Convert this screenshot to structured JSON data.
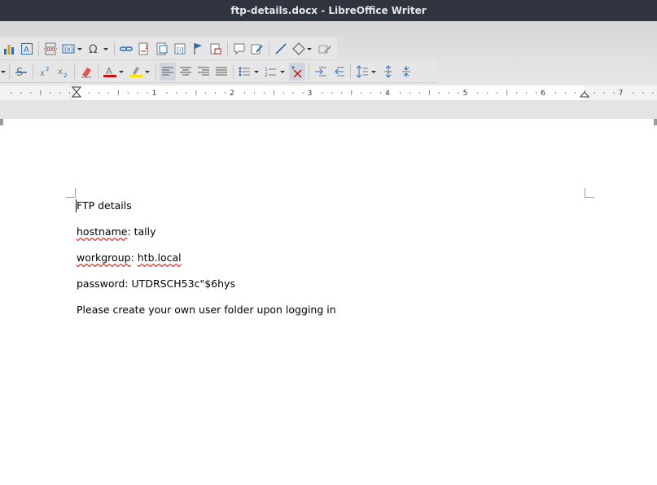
{
  "window": {
    "title": "ftp-details.docx - LibreOffice Writer"
  },
  "ruler": {
    "labels": [
      "1",
      "2",
      "3",
      "4",
      "5",
      "6",
      "7"
    ]
  },
  "document": {
    "heading": "FTP details",
    "hostname_label": "hostname",
    "hostname_value": ": tally",
    "workgroup_label": "workgroup",
    "workgroup_sep": ": ",
    "workgroup_value": "htb.local",
    "password_line": "password: UTDRSCH53c\"$6hys",
    "note": "Please create your own user folder upon logging in"
  },
  "colors": {
    "titlebar": "#2f343f",
    "font_color": "#cc1111",
    "highlight": "#f5e400",
    "accent_blue": "#2a6ebb"
  },
  "icons": {
    "toolbar1": [
      "chart-icon",
      "text-box-icon",
      "page-break-icon",
      "field-icon",
      "special-character-icon",
      "hyperlink-icon",
      "footnote-icon",
      "endnote-icon",
      "bookmark-icon",
      "cross-reference-icon",
      "comment-icon",
      "track-changes-icon",
      "line-icon",
      "basic-shapes-icon",
      "draw-icon"
    ],
    "toolbar2": [
      "strikethrough-icon",
      "superscript-icon",
      "subscript-icon",
      "clear-formatting-icon",
      "font-color-icon",
      "highlight-icon",
      "align-left-icon",
      "align-center-icon",
      "align-right-icon",
      "justify-icon",
      "bullet-list-icon",
      "numbered-list-icon",
      "no-list-icon",
      "increase-indent-icon",
      "decrease-indent-icon",
      "line-spacing-icon",
      "increase-paragraph-spacing-icon",
      "decrease-paragraph-spacing-icon"
    ]
  }
}
